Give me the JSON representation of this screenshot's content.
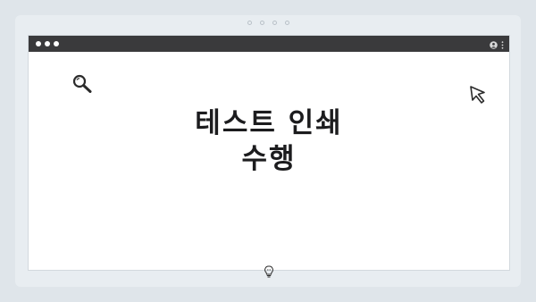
{
  "title_lines": [
    "테스트 인쇄",
    "수행"
  ],
  "icons": {
    "frame_dots": "pagination-dots",
    "window_controls": "traffic-light-dots",
    "toolbar": [
      "user-icon",
      "more-vertical-icon"
    ],
    "decor": [
      "search-icon",
      "cursor-icon",
      "lightbulb-icon"
    ]
  },
  "colors": {
    "background": "#dfe5ea",
    "titlebar": "#3a3a3c",
    "text": "#1c1c1e"
  }
}
